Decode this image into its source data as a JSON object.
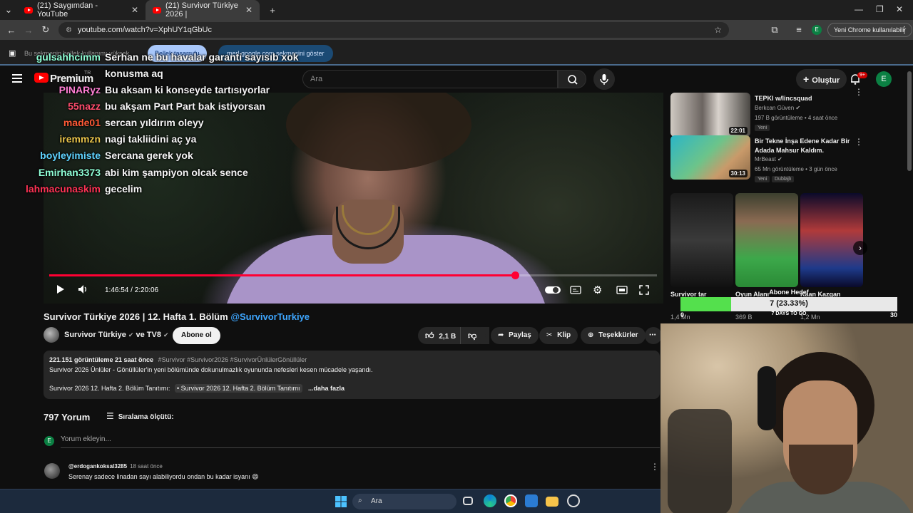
{
  "tabs": [
    {
      "label": "(21) Saygımdan - YouTube"
    },
    {
      "label": "(21) Survivor Türkiye 2026 |"
    }
  ],
  "address": {
    "url": "youtube.com/watch?v=XphUY1qGbUc",
    "update_button": "Yeni Chrome kullanılabilir"
  },
  "infobar": {
    "text": "Bu sekmenin bellek kullanımı yüksek",
    "btn_primary": "Bellek tasarrufu",
    "btn_secondary": "merl google.com sekmesini göster"
  },
  "masthead": {
    "logo_text": "Premium",
    "logo_region": "TR",
    "search_placeholder": "Ara",
    "create_label": "Oluştur",
    "notif_badge": "9+",
    "avatar_letter": "E"
  },
  "chat": [
    {
      "user": "gulsahhcimm",
      "msg": "Serhan ne bu havalar garanti sayısıb xok",
      "color": "#ffffff"
    },
    {
      "user": "",
      "msg": "konusma aq",
      "color": "#ffffff"
    },
    {
      "user": "PINARyz",
      "msg": "Bu aksam ki konseyde tartısıyorlar",
      "color": "#ff7fd4"
    },
    {
      "user": "55nazz",
      "msg": "bu akşam Part Part bak istiyorsan",
      "color": "#ff4d6d"
    },
    {
      "user": "made01",
      "msg": "sercan yıldırım oleyy",
      "color": "#ff5a36"
    },
    {
      "user": "iremmzn",
      "msg": "nagi takliidini aç ya",
      "color": "#e7c34a"
    },
    {
      "user": "boyleyimiste",
      "msg": "Sercana gerek yok",
      "color": "#5fd3ff"
    },
    {
      "user": "Emirhan3373",
      "msg": "abi kim şampiyon olcak sence",
      "color": "#8fffd6"
    },
    {
      "user": "lahmacunaskim",
      "msg": "gecelim",
      "color": "#ff3355"
    }
  ],
  "player": {
    "time": "1:46:54 / 2:20:06",
    "progress_fraction": 0.767
  },
  "video": {
    "title": "Survivor Türkiye 2026 | 12. Hafta 1. Bölüm",
    "title_tag": "@SurvivorTurkiye",
    "channel": "Survivor Türkiye",
    "channel_suffix": "ve TV8",
    "subscribe": "Abone ol",
    "likes": "2,1 B",
    "share": "Paylaş",
    "clip": "Klip",
    "thanks": "Teşekkürler"
  },
  "description": {
    "stats": "221.151 görüntüleme  21 saat önce",
    "tags": "#Survivor #Survivor2026 #SurvivorÜnlülerGönüllüler",
    "line1": "Survivor 2026 Ünlüler - Gönüllüler'in yeni bölümünde dokunulmazlık oyununda nefesleri kesen mücadele yaşandı.",
    "line2": "Survivor 2026 12. Hafta 2. Bölüm Tanıtımı:",
    "link": "• Survivor 2026 12. Hafta 2. Bölüm Tanıtımı",
    "more": "...daha fazla"
  },
  "comments": {
    "count": "797 Yorum",
    "sort": "Sıralama ölçütü:",
    "placeholder": "Yorum ekleyin...",
    "first": {
      "user": "@erdogankoksal3285",
      "time": "18 saat önce",
      "text": "Serenay sadece linadan sayı alabiliyordu ondan bu kadar isyanı 😄"
    }
  },
  "sidebar": {
    "recs": [
      {
        "title": "TEPKI w/lincsquad",
        "channel": "Berkcan Güven",
        "meta": "197 B görüntüleme • 4 saat önce",
        "badge": "Yeni",
        "duration": "22:01"
      },
      {
        "title": "Bir Tekne İnşa Edene Kadar Bir Adada Mahsur Kaldım.",
        "channel": "MrBeast",
        "meta": "65 Mn görüntüleme • 3 gün önce",
        "badge": "Yeni",
        "badge2": "Dublajlı",
        "duration": "30:13"
      }
    ],
    "shorts": [
      {
        "title": "Survivor tar",
        "views": "1,4 Mn"
      },
      {
        "title": "Oyun Alanı",
        "views": "369 B"
      },
      {
        "title": "Kaan Kazgan",
        "views": "1,2 Mn"
      }
    ]
  },
  "goal": {
    "label": "Abone Hedef",
    "text": "7 (23.33%)",
    "fraction": 0.2333,
    "min": "0",
    "max": "30",
    "days": "7 DAYS TO GO"
  },
  "taskbar": {
    "search": "Ara"
  }
}
